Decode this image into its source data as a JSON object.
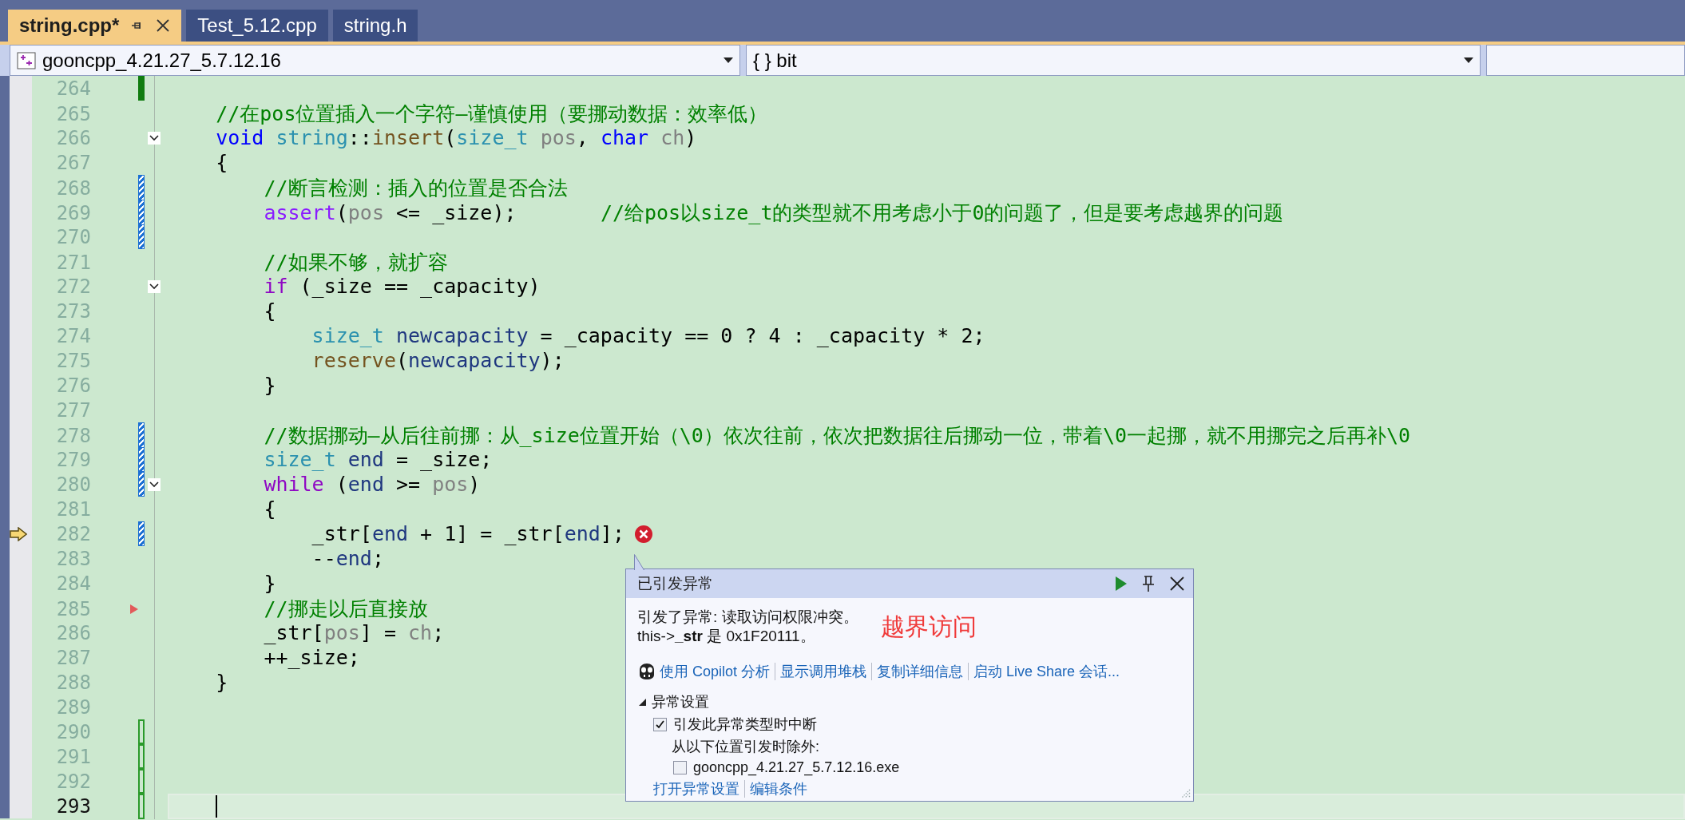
{
  "tabs": [
    {
      "label": "string.cpp*",
      "selected": true
    },
    {
      "label": "Test_5.12.cpp",
      "selected": false
    },
    {
      "label": "string.h",
      "selected": false
    }
  ],
  "nav": {
    "project": "gooncpp_4.21.27_5.7.12.16",
    "scope": "{ } bit"
  },
  "lines": [
    {
      "number": "264",
      "fold": false,
      "change": {
        "kind": "saved"
      }
    },
    {
      "number": "265",
      "fold": false,
      "tokens": [
        {
          "kind": "comment",
          "text": "    //在pos位置插入一个字符—谨慎使用（要挪动数据：效率低）"
        }
      ]
    },
    {
      "number": "266",
      "fold": true,
      "tokens": [
        {
          "kind": "keyword",
          "text": "    void"
        },
        {
          "kind": "class",
          "text": " string"
        },
        {
          "kind": "plain",
          "text": "::"
        },
        {
          "kind": "function",
          "text": "insert"
        },
        {
          "kind": "plain",
          "text": "("
        },
        {
          "kind": "type",
          "text": "size_t"
        },
        {
          "kind": "param",
          "text": " pos"
        },
        {
          "kind": "plain",
          "text": ", "
        },
        {
          "kind": "keyword",
          "text": "char"
        },
        {
          "kind": "param",
          "text": " ch"
        },
        {
          "kind": "plain",
          "text": ")"
        }
      ]
    },
    {
      "number": "267",
      "fold": false,
      "tokens": [
        {
          "kind": "plain",
          "text": "    {"
        }
      ]
    },
    {
      "number": "268",
      "fold": false,
      "change": {
        "kind": "hatched"
      },
      "tokens": [
        {
          "kind": "comment",
          "text": "        //断言检测：插入的位置是否合法"
        }
      ]
    },
    {
      "number": "269",
      "fold": false,
      "change": {
        "kind": "hatched"
      },
      "tokens": [
        {
          "kind": "macro",
          "text": "        assert"
        },
        {
          "kind": "plain",
          "text": "("
        },
        {
          "kind": "param",
          "text": "pos"
        },
        {
          "kind": "plain",
          "text": " <= _size);       "
        },
        {
          "kind": "comment",
          "text": "//给pos以size_t的类型就不用考虑小于0的问题了，但是要考虑越界的问题"
        }
      ]
    },
    {
      "number": "270",
      "fold": false,
      "change": {
        "kind": "hatched"
      }
    },
    {
      "number": "271",
      "fold": false,
      "tokens": [
        {
          "kind": "comment",
          "text": "        //如果不够，就扩容"
        }
      ]
    },
    {
      "number": "272",
      "fold": true,
      "tokens": [
        {
          "kind": "control",
          "text": "        if"
        },
        {
          "kind": "plain",
          "text": " (_size == _capacity)"
        }
      ]
    },
    {
      "number": "273",
      "fold": false,
      "tokens": [
        {
          "kind": "plain",
          "text": "        {"
        }
      ]
    },
    {
      "number": "274",
      "fold": false,
      "tokens": [
        {
          "kind": "type",
          "text": "            size_t"
        },
        {
          "kind": "local",
          "text": " newcapacity"
        },
        {
          "kind": "plain",
          "text": " = _capacity == 0 ? 4 : _capacity * 2;"
        }
      ]
    },
    {
      "number": "275",
      "fold": false,
      "tokens": [
        {
          "kind": "function",
          "text": "            reserve"
        },
        {
          "kind": "plain",
          "text": "("
        },
        {
          "kind": "local",
          "text": "newcapacity"
        },
        {
          "kind": "plain",
          "text": ");"
        }
      ]
    },
    {
      "number": "276",
      "fold": false,
      "tokens": [
        {
          "kind": "plain",
          "text": "        }"
        }
      ]
    },
    {
      "number": "277",
      "fold": false
    },
    {
      "number": "278",
      "fold": false,
      "change": {
        "kind": "hatched"
      },
      "tokens": [
        {
          "kind": "comment",
          "text": "        //数据挪动—从后往前挪：从_size位置开始（\\0）依次往前，依次把数据往后挪动一位，带着\\0一起挪，就不用挪完之后再补\\0"
        }
      ]
    },
    {
      "number": "279",
      "fold": false,
      "change": {
        "kind": "hatched"
      },
      "tokens": [
        {
          "kind": "type",
          "text": "        size_t"
        },
        {
          "kind": "local",
          "text": " end"
        },
        {
          "kind": "plain",
          "text": " = _size;"
        }
      ]
    },
    {
      "number": "280",
      "fold": true,
      "change": {
        "kind": "hatched"
      },
      "tokens": [
        {
          "kind": "control",
          "text": "        while"
        },
        {
          "kind": "plain",
          "text": " ("
        },
        {
          "kind": "local",
          "text": "end"
        },
        {
          "kind": "plain",
          "text": " >= "
        },
        {
          "kind": "param",
          "text": "pos"
        },
        {
          "kind": "plain",
          "text": ")"
        }
      ]
    },
    {
      "number": "281",
      "fold": false,
      "tokens": [
        {
          "kind": "plain",
          "text": "        {"
        }
      ]
    },
    {
      "number": "282",
      "fold": false,
      "change": {
        "kind": "hatched"
      },
      "current_statement": true,
      "error": true,
      "tokens": [
        {
          "kind": "plain",
          "text": "            _str["
        },
        {
          "kind": "local",
          "text": "end"
        },
        {
          "kind": "plain",
          "text": " + 1] = _str["
        },
        {
          "kind": "local",
          "text": "end"
        },
        {
          "kind": "plain",
          "text": "];"
        }
      ]
    },
    {
      "number": "283",
      "fold": false,
      "tokens": [
        {
          "kind": "plain",
          "text": "            --"
        },
        {
          "kind": "local",
          "text": "end"
        },
        {
          "kind": "plain",
          "text": ";"
        }
      ]
    },
    {
      "number": "284",
      "fold": false,
      "tokens": [
        {
          "kind": "plain",
          "text": "        }"
        }
      ]
    },
    {
      "number": "285",
      "fold": false,
      "run_marker": true,
      "tokens": [
        {
          "kind": "comment",
          "text": "        //挪走以后直接放"
        }
      ]
    },
    {
      "number": "286",
      "fold": false,
      "tokens": [
        {
          "kind": "plain",
          "text": "        _str["
        },
        {
          "kind": "param",
          "text": "pos"
        },
        {
          "kind": "plain",
          "text": "] = "
        },
        {
          "kind": "param",
          "text": "ch"
        },
        {
          "kind": "plain",
          "text": ";"
        }
      ]
    },
    {
      "number": "287",
      "fold": false,
      "tokens": [
        {
          "kind": "plain",
          "text": "        ++_size;"
        }
      ]
    },
    {
      "number": "288",
      "fold": false,
      "tokens": [
        {
          "kind": "plain",
          "text": "    }"
        }
      ]
    },
    {
      "number": "289",
      "fold": false
    },
    {
      "number": "290",
      "fold": false,
      "change": {
        "kind": "outlined"
      }
    },
    {
      "number": "291",
      "fold": false,
      "change": {
        "kind": "outlined"
      }
    },
    {
      "number": "292",
      "fold": false,
      "change": {
        "kind": "outlined"
      }
    },
    {
      "number": "293",
      "fold": false,
      "change": {
        "kind": "outlined"
      },
      "caret": true
    }
  ],
  "exception": {
    "title": "已引发异常",
    "message": "引发了异常: 读取访问权限冲突。",
    "detail": "this->**_str** 是 0x1F20111。",
    "annotation": "越界访问",
    "links": [
      {
        "label": "使用 Copilot 分析",
        "kind": "copilot"
      },
      {
        "label": "显示调用堆栈",
        "kind": "plain"
      },
      {
        "label": "复制详细信息",
        "kind": "plain"
      },
      {
        "label": "启动 Live Share 会话...",
        "kind": "plain"
      }
    ],
    "settings": {
      "title": "异常设置",
      "expanded": true,
      "break_option": {
        "label": "引发此异常类型时中断",
        "checked": true
      },
      "except_label": "从以下位置引发时除外:",
      "modules": [
        {
          "label": "gooncpp_4.21.27_5.7.12.16.exe",
          "checked": false
        }
      ],
      "links": [
        "打开异常设置",
        "编辑条件"
      ]
    }
  }
}
